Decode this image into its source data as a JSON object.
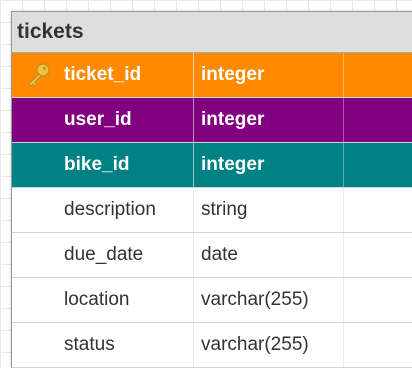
{
  "table": {
    "name": "tickets",
    "columns": [
      {
        "name": "ticket_id",
        "type": "integer",
        "key": "primary",
        "color": "#ff8a00",
        "icon": "key-icon"
      },
      {
        "name": "user_id",
        "type": "integer",
        "key": "foreign",
        "color": "#80007f"
      },
      {
        "name": "bike_id",
        "type": "integer",
        "key": "foreign",
        "color": "#008285"
      },
      {
        "name": "description",
        "type": "string",
        "key": "none"
      },
      {
        "name": "due_date",
        "type": "date",
        "key": "none"
      },
      {
        "name": "location",
        "type": "varchar(255)",
        "key": "none"
      },
      {
        "name": "status",
        "type": "varchar(255)",
        "key": "none"
      }
    ]
  }
}
